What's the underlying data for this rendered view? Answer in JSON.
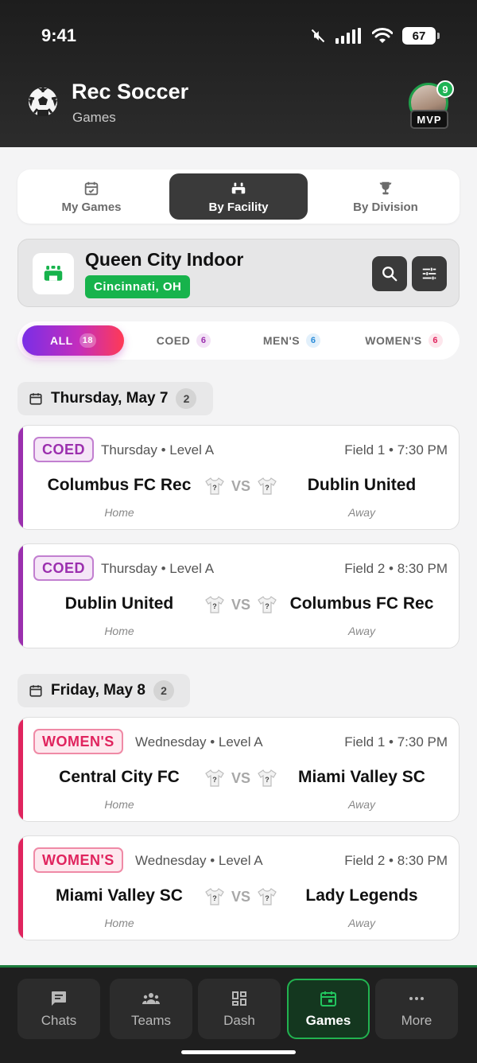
{
  "status": {
    "time": "9:41",
    "battery": "67"
  },
  "app": {
    "title": "Rec Soccer",
    "subtitle": "Games",
    "notification_count": "9",
    "badge": "MVP"
  },
  "tabs": [
    {
      "label": "My Games"
    },
    {
      "label": "By Facility"
    },
    {
      "label": "By Division"
    }
  ],
  "facility": {
    "name": "Queen City Indoor",
    "location": "Cincinnati, OH"
  },
  "filters": [
    {
      "label": "ALL",
      "count": "18"
    },
    {
      "label": "COED",
      "count": "6"
    },
    {
      "label": "MEN'S",
      "count": "6"
    },
    {
      "label": "WOMEN'S",
      "count": "6"
    }
  ],
  "days": [
    {
      "label": "Thursday, May 7",
      "count": "2"
    },
    {
      "label": "Friday, May 8",
      "count": "2"
    }
  ],
  "games": [
    {
      "division": "COED",
      "meta": "Thursday • Level A",
      "field": "Field 1 • 7:30 PM",
      "home": "Columbus FC Rec",
      "away": "Dublin United",
      "home_label": "Home",
      "away_label": "Away",
      "vs": "VS",
      "shirt": "?"
    },
    {
      "division": "COED",
      "meta": "Thursday • Level A",
      "field": "Field 2 • 8:30 PM",
      "home": "Dublin United",
      "away": "Columbus FC Rec",
      "home_label": "Home",
      "away_label": "Away",
      "vs": "VS",
      "shirt": "?"
    },
    {
      "division": "WOMEN'S",
      "meta": "Wednesday • Level A",
      "field": "Field 1 • 7:30 PM",
      "home": "Central City FC",
      "away": "Miami Valley SC",
      "home_label": "Home",
      "away_label": "Away",
      "vs": "VS",
      "shirt": "?"
    },
    {
      "division": "WOMEN'S",
      "meta": "Wednesday • Level A",
      "field": "Field 2 • 8:30 PM",
      "home": "Miami Valley SC",
      "away": "Lady Legends",
      "home_label": "Home",
      "away_label": "Away",
      "vs": "VS",
      "shirt": "?"
    }
  ],
  "nav": [
    {
      "label": "Chats"
    },
    {
      "label": "Teams"
    },
    {
      "label": "Dash"
    },
    {
      "label": "Games"
    },
    {
      "label": "More"
    }
  ],
  "colors": {
    "coed": "#9b2fae",
    "coed_bg": "#f5e6f7",
    "womens": "#e0245e",
    "womens_bg": "#fde8ee",
    "green": "#17b34c"
  }
}
